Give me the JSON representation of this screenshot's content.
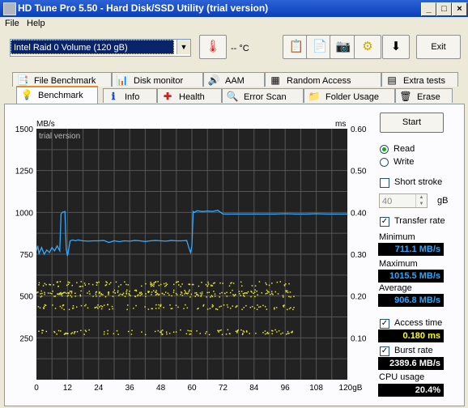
{
  "window": {
    "title": "HD Tune Pro 5.50 - Hard Disk/SSD Utility (trial version)"
  },
  "menu": {
    "file": "File",
    "help": "Help"
  },
  "toolbar": {
    "drive": "Intel   Raid 0 Volume (120 gB)",
    "temperature": "-- °C",
    "exit": "Exit"
  },
  "tabs_top": [
    "File Benchmark",
    "Disk monitor",
    "AAM",
    "Random Access",
    "Extra tests"
  ],
  "tabs_bottom": [
    "Benchmark",
    "Info",
    "Health",
    "Error Scan",
    "Folder Usage",
    "Erase"
  ],
  "benchmark": {
    "start": "Start",
    "read": "Read",
    "write": "Write",
    "short_stroke": "Short stroke",
    "short_stroke_value": "40",
    "short_stroke_unit": "gB",
    "transfer_rate": "Transfer rate",
    "minimum_label": "Minimum",
    "minimum_value": "711.1 MB/s",
    "maximum_label": "Maximum",
    "maximum_value": "1015.5 MB/s",
    "average_label": "Average",
    "average_value": "906.8 MB/s",
    "access_time_label": "Access time",
    "access_time_value": "0.180 ms",
    "burst_rate_label": "Burst rate",
    "burst_rate_value": "2389.6 MB/s",
    "cpu_usage_label": "CPU usage",
    "cpu_usage_value": "20.4%"
  },
  "chart_data": {
    "type": "line",
    "watermark": "trial version",
    "ylabel_left": "MB/s",
    "ylabel_right": "ms",
    "y_left_ticks": [
      "1500",
      "1250",
      "1000",
      "750",
      "500",
      "250"
    ],
    "y_right_ticks": [
      "0.60",
      "0.50",
      "0.40",
      "0.30",
      "0.20",
      "0.10"
    ],
    "x_ticks": [
      "0",
      "12",
      "24",
      "36",
      "48",
      "60",
      "72",
      "84",
      "96",
      "108",
      "120gB"
    ],
    "ylim_left": [
      0,
      1500
    ],
    "ylim_right": [
      0,
      0.6
    ],
    "xlim": [
      0,
      120
    ],
    "grid": true,
    "transfer_series": {
      "x": [
        0,
        0.5,
        1,
        2,
        3,
        4,
        5,
        6,
        7,
        8,
        9,
        9.5,
        10,
        11,
        11.5,
        12,
        13,
        14,
        15,
        16,
        18,
        20,
        22,
        24,
        26,
        28,
        30,
        32,
        34,
        36,
        38,
        40,
        42,
        44,
        46,
        48,
        50,
        52,
        54,
        56,
        58,
        59,
        59.5,
        60,
        60.5,
        61,
        62,
        64,
        66,
        68,
        70,
        72,
        74,
        76,
        80,
        84,
        88,
        92,
        96,
        100,
        104,
        108,
        112,
        116,
        120
      ],
      "y": [
        770,
        800,
        755,
        790,
        750,
        775,
        760,
        790,
        770,
        800,
        770,
        990,
        1000,
        1005,
        780,
        740,
        830,
        835,
        830,
        835,
        830,
        828,
        830,
        830,
        832,
        820,
        830,
        825,
        830,
        828,
        832,
        830,
        826,
        830,
        832,
        830,
        828,
        832,
        830,
        830,
        832,
        780,
        760,
        800,
        1005,
        1000,
        1010,
        1005,
        1008,
        1006,
        1012,
        990,
        990,
        990,
        990,
        990,
        990,
        990,
        992,
        990,
        990,
        992,
        990,
        990,
        990
      ]
    },
    "access_time_bands_ms": [
      0.23,
      0.21,
      0.205,
      0.175,
      0.115
    ],
    "colors": {
      "background": "#222222",
      "grid": "#555555",
      "transfer": "#33aaff",
      "access": "#e6e632"
    }
  }
}
